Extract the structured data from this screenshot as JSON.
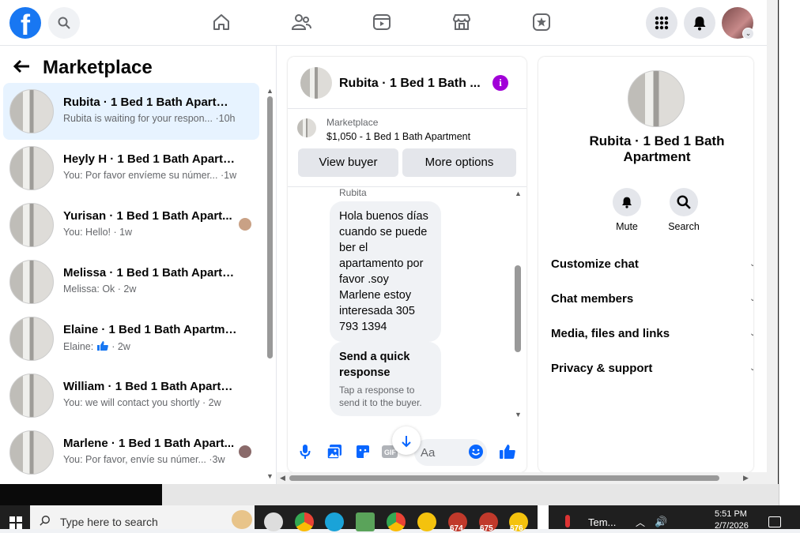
{
  "topnav": {
    "logo_letter": "f",
    "icons": [
      "search-icon",
      "home-icon",
      "friends-icon",
      "watch-icon",
      "marketplace-icon",
      "gaming-icon",
      "menu-grid-icon",
      "notifications-icon",
      "account-avatar"
    ]
  },
  "left": {
    "title": "Marketplace",
    "conversations": [
      {
        "title": "Rubita · 1 Bed 1 Bath Apartment",
        "subtitle": "Rubita is waiting for your respon... ·10h",
        "active": true
      },
      {
        "title": "Heyly H · 1 Bed 1 Bath Apartment",
        "subtitle": "You: Por favor envíeme su númer... ·1w",
        "active": false
      },
      {
        "title": "Yurisan · 1 Bed 1 Bath Apart...",
        "subtitle": "You: Hello! · 1w",
        "active": false,
        "seen_avatar": true
      },
      {
        "title": "Melissa · 1 Bed 1 Bath Apartment",
        "subtitle": "Melissa: Ok · 2w",
        "active": false
      },
      {
        "title": "Elaine · 1 Bed 1 Bath Apartment",
        "subtitle_prefix": "Elaine:",
        "subtitle_suffix": "· 2w",
        "active": false
      },
      {
        "title": "William · 1 Bed 1 Bath Apartment",
        "subtitle": "You: we will contact you shortly · 2w",
        "active": false
      },
      {
        "title": "Marlene · 1 Bed 1 Bath Apart...",
        "subtitle": "You: Por favor, envíe su númer... ·3w",
        "active": false,
        "seen_avatar": true
      }
    ]
  },
  "chat": {
    "header_title": "Rubita · 1 Bed 1 Bath ...",
    "info_glyph": "i",
    "listing_source": "Marketplace",
    "listing_price_title": "$1,050 - 1 Bed 1 Bath Apartment",
    "view_buyer": "View buyer",
    "more_options": "More options",
    "sender": "Rubita",
    "message": "Hola buenos días cuando se puede ber el apartamento por favor .soy Marlene estoy interesada 305 793 1394",
    "quick_title": "Send a quick response",
    "quick_sub": "Tap a response to send it to the buyer.",
    "composer_placeholder": "Aa"
  },
  "details": {
    "title": "Rubita · 1 Bed 1 Bath Apartment",
    "mute": "Mute",
    "search": "Search",
    "menu": [
      "Customize chat",
      "Chat members",
      "Media, files and links",
      "Privacy & support"
    ]
  },
  "taskbar": {
    "search_text": "Type here to search",
    "badges": [
      "674",
      "675",
      "676"
    ],
    "weather": "Tem...",
    "time": "5:51 PM",
    "date": "2/7/2026"
  },
  "colors": {
    "brand": "#1877f2",
    "active_conv": "#e7f3ff",
    "info": "#a100d8",
    "messenger_blue": "#0866ff"
  }
}
